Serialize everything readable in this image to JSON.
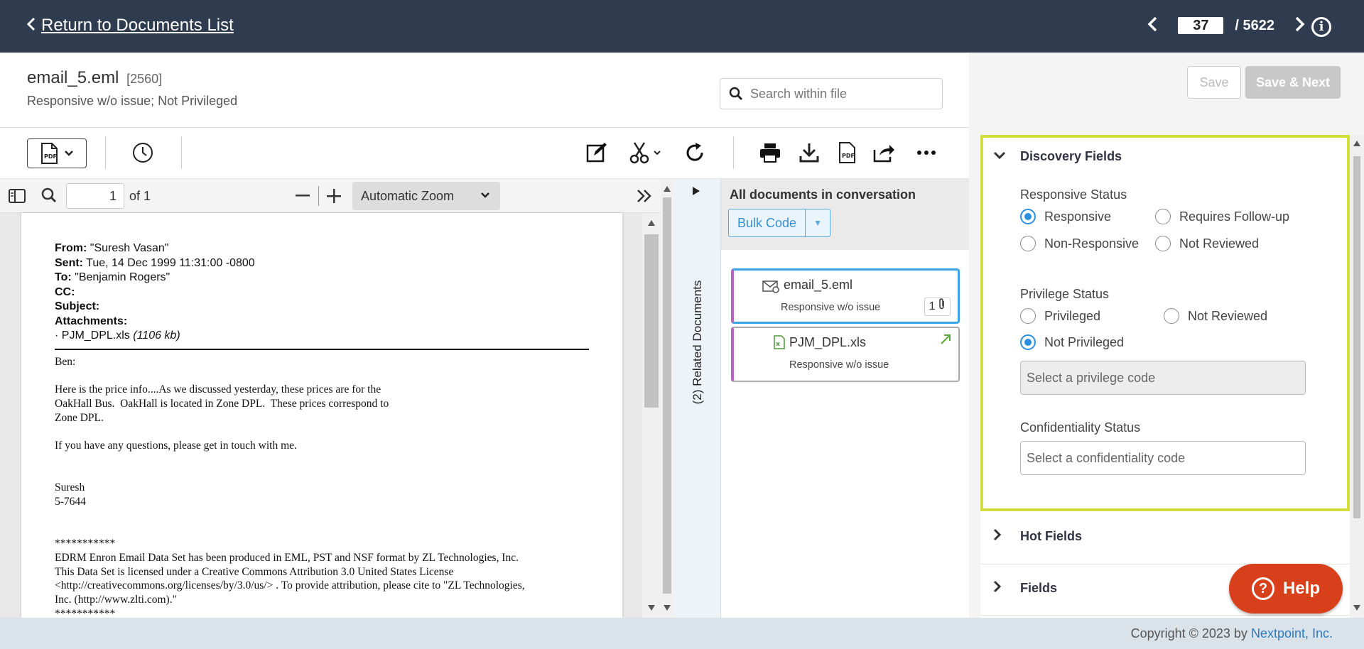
{
  "topbar": {
    "back_label": "Return to Documents List",
    "current_page": "37",
    "total_pages": "/ 5622"
  },
  "document": {
    "title": "email_5.eml",
    "id": "[2560]",
    "subtitle": "Responsive w/o issue; Not Privileged",
    "search_placeholder": "Search within file"
  },
  "pdf_viewer": {
    "page_input": "1",
    "page_of": "of 1",
    "zoom": "Automatic Zoom"
  },
  "email": {
    "from_label": "From:",
    "from": "\"Suresh Vasan\"",
    "sent_label": "Sent:",
    "sent": "Tue, 14 Dec 1999 11:31:00 -0800",
    "to_label": "To:",
    "to": "\"Benjamin Rogers\"",
    "cc_label": "CC:",
    "subject_label": "Subject:",
    "attachments_label": "Attachments:",
    "attachment_name": "· PJM_DPL.xls",
    "attachment_size": "(1106 kb)",
    "body": "Ben:\n\nHere is the price info....As we discussed yesterday, these prices are for the\nOakHall Bus.  OakHall is located in Zone DPL.  These prices correspond to\nZone DPL.\n\nIf you have any questions, please get in touch with me.\n\n\nSuresh\n5-7644\n\n\n***********\nEDRM Enron Email Data Set has been produced in EML, PST and NSF format by ZL Technologies, Inc.\nThis Data Set is licensed under a Creative Commons Attribution 3.0 United States License\n<http://creativecommons.org/licenses/by/3.0/us/> . To provide attribution, please cite to \"ZL Technologies,\nInc. (http://www.zlti.com).\"\n***********"
  },
  "related": {
    "tab_label": "(2) Related Documents",
    "title": "All documents in conversation",
    "bulk_code": "Bulk Code",
    "docs": [
      {
        "name": "email_5.eml",
        "status": "Responsive w/o issue",
        "attachments": "1"
      },
      {
        "name": "PJM_DPL.xls",
        "status": "Responsive w/o issue"
      }
    ]
  },
  "coding": {
    "save": "Save",
    "save_next": "Save & Next",
    "discovery_title": "Discovery Fields",
    "responsive_label": "Responsive Status",
    "responsive_options": [
      "Responsive",
      "Requires Follow-up",
      "Non-Responsive",
      "Not Reviewed"
    ],
    "responsive_selected": "Responsive",
    "privilege_label": "Privilege Status",
    "privilege_options": [
      "Privileged",
      "Not Reviewed",
      "Not Privileged"
    ],
    "privilege_selected": "Not Privileged",
    "privilege_code_placeholder": "Select a privilege code",
    "confidentiality_label": "Confidentiality Status",
    "confidentiality_placeholder": "Select a confidentiality code",
    "hot_fields": "Hot Fields",
    "fields": "Fields"
  },
  "help": "Help",
  "footer": {
    "copyright": "Copyright © 2023 by ",
    "brand": "Nextpoint, Inc."
  },
  "colors": {
    "topbar": "#2f3c4f",
    "accent": "#2b8fe0",
    "highlight": "#d3de3c",
    "help": "#d8401c"
  }
}
